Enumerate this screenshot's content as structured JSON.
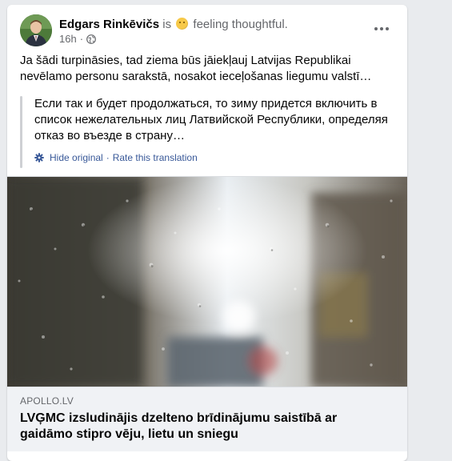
{
  "post": {
    "author": "Edgars Rinkēvičs",
    "is_text": "is",
    "feeling": "feeling thoughtful.",
    "time": "16h",
    "privacy_icon": "globe-icon",
    "more_icon": "more-options-icon",
    "text": "Ja šādi turpināsies, tad ziema būs jāiekļauj Latvijas Republikai nevēlamo personu sarakstā, nosakot ieceļošanas liegumu valstī…"
  },
  "translation": {
    "text": "Если так и будет продолжаться, то зиму придется включить в список нежелательных лиц Латвийской Республики, определяя отказ во въезде в страну…",
    "settings_icon": "gear-icon",
    "hide_label": "Hide original",
    "separator": "·",
    "rate_label": "Rate this translation"
  },
  "link": {
    "domain": "APOLLO.LV",
    "title": "LVĢMC izsludinājis dzelteno brīdinājumu saistībā ar gaidāmo stipro vēju, lietu un sniegu"
  },
  "colors": {
    "link_blue": "#385898",
    "secondary_text": "#65676b",
    "background": "#e9ebee"
  }
}
